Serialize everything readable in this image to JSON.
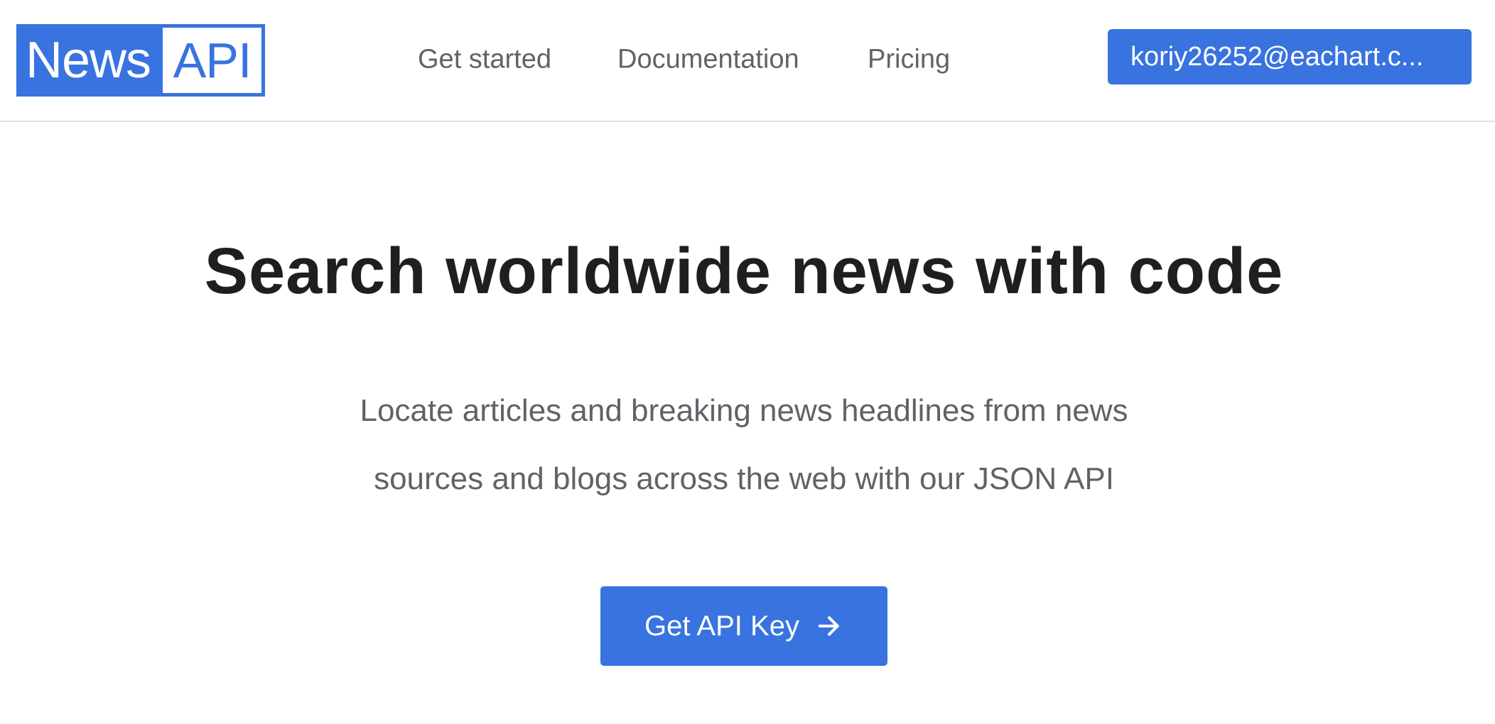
{
  "header": {
    "logo": {
      "word_news": "News",
      "word_api": "API"
    },
    "nav": [
      {
        "label": "Get started"
      },
      {
        "label": "Documentation"
      },
      {
        "label": "Pricing"
      }
    ],
    "account_button_label": "koriy26252@eachart.c..."
  },
  "hero": {
    "title": "Search worldwide news with code",
    "subtitle_line1": "Locate articles and breaking news headlines from news",
    "subtitle_line2": "sources and blogs across the web with our JSON API",
    "cta_label": "Get API Key",
    "cta_icon": "arrow-right-icon"
  },
  "colors": {
    "brand_blue": "#3873df",
    "title_text": "#1f1f1f",
    "muted_text": "#5f6368",
    "divider": "#e2e2e2"
  }
}
